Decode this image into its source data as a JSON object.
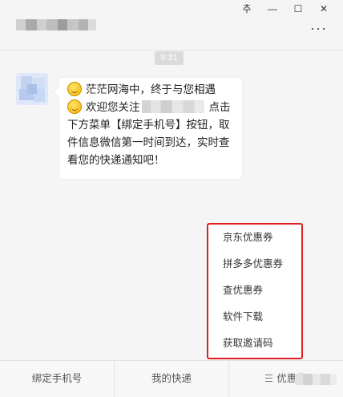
{
  "window": {
    "controls": {
      "pin": "추",
      "minimize": "—",
      "maximize": "☐",
      "close": "✕"
    },
    "more_label": "···"
  },
  "chat": {
    "time": "9:31",
    "message": {
      "line1": "茫茫网海中，终于与您相遇",
      "line2_prefix": "欢迎您关注",
      "line2_suffix": "点击",
      "line3": "下方菜单【绑定手机号】按钮，取",
      "line4": "件信息微信第一时间到达，实时查",
      "line5": "看您的快递通知吧！"
    }
  },
  "popup_menu": {
    "items": [
      "京东优惠券",
      "拼多多优惠券",
      "查优惠券",
      "软件下载",
      "获取邀请码"
    ],
    "highlight_color": "#e02020"
  },
  "bottom_menu": {
    "tabs": [
      "绑定手机号",
      "我的快递",
      "优惠券"
    ]
  }
}
